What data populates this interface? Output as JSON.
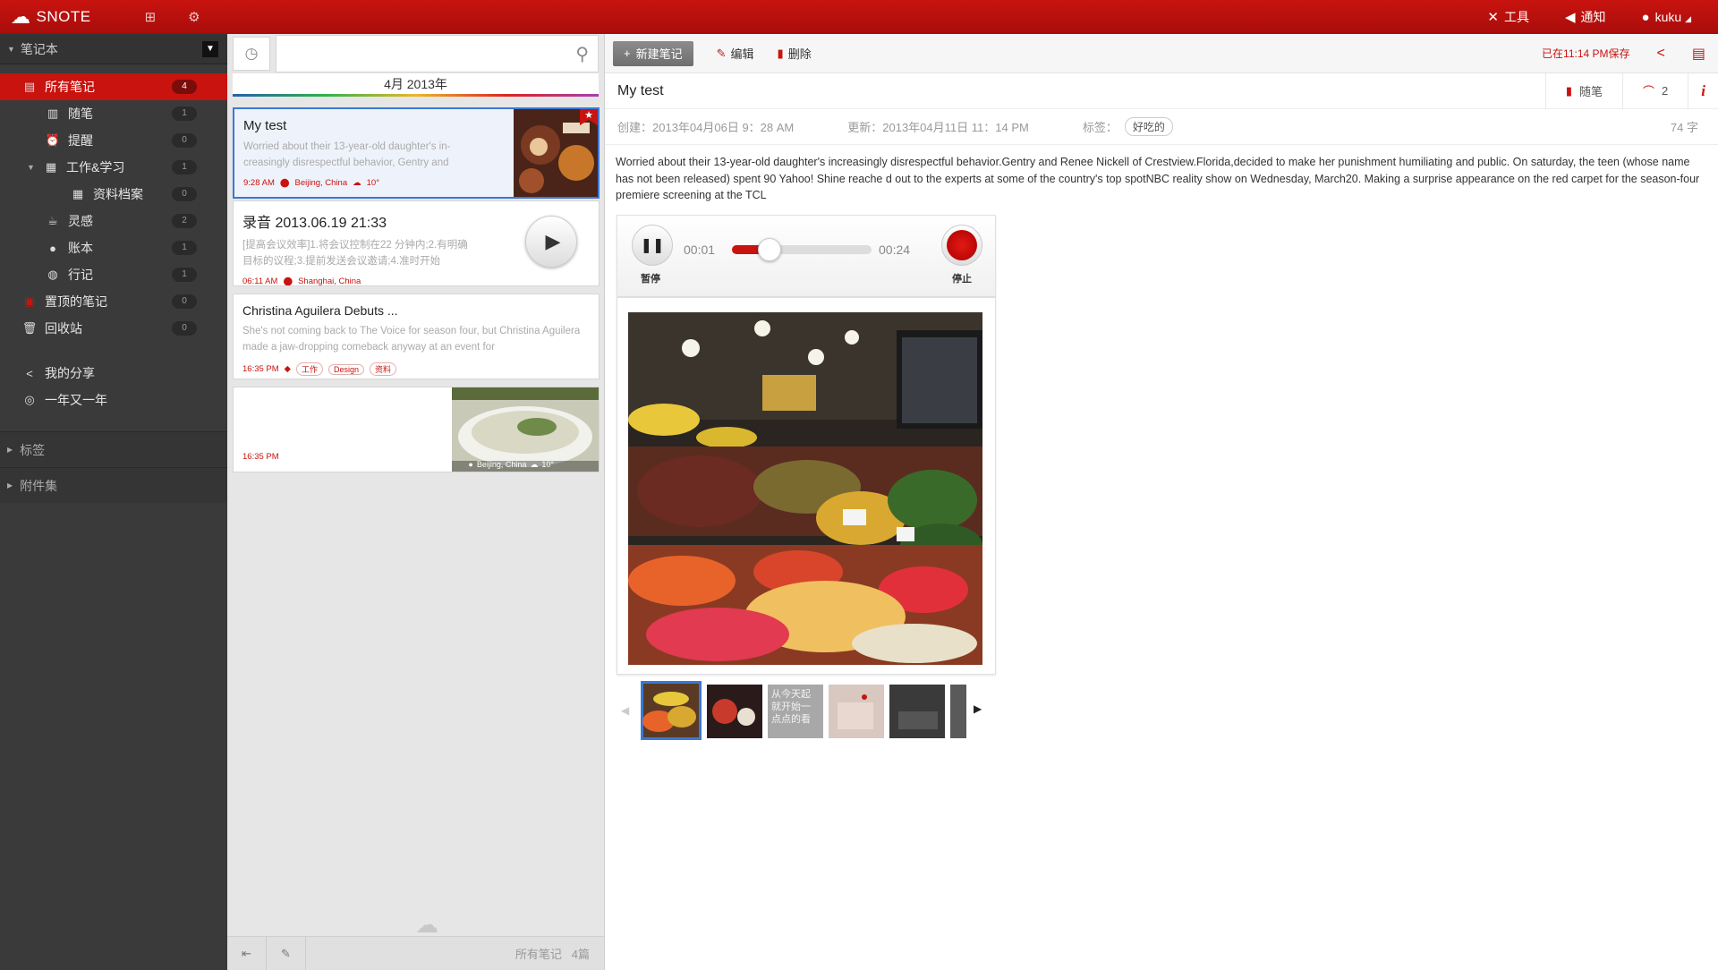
{
  "app": {
    "name": "SNOTE",
    "tools": "工具",
    "notify": "通知",
    "user": "kuku"
  },
  "sidebar": {
    "header": "笔记本",
    "items": [
      {
        "label": "所有笔记",
        "count": "4",
        "icon": "notebook-icon"
      },
      {
        "label": "随笔",
        "count": "1",
        "icon": "book-icon"
      },
      {
        "label": "提醒",
        "count": "0",
        "icon": "alarm-icon"
      },
      {
        "label": "工作&学习",
        "count": "1",
        "icon": "books-icon"
      },
      {
        "label": "资料档案",
        "count": "0",
        "icon": "archive-icon"
      },
      {
        "label": "灵感",
        "count": "2",
        "icon": "cup-icon"
      },
      {
        "label": "账本",
        "count": "1",
        "icon": "piggy-bank-icon"
      },
      {
        "label": "行记",
        "count": "1",
        "icon": "speech-icon"
      },
      {
        "label": "置顶的笔记",
        "count": "0",
        "icon": "pin-icon"
      },
      {
        "label": "回收站",
        "count": "0",
        "icon": "trash-icon"
      }
    ],
    "extras": [
      {
        "label": "我的分享",
        "icon": "share-icon"
      },
      {
        "label": "一年又一年",
        "icon": "swirl-icon"
      }
    ],
    "sections": [
      "标签",
      "附件集"
    ]
  },
  "list": {
    "month": "4月 2013年",
    "notes": [
      {
        "title": "My test",
        "desc": "Worried about their 13-year-old daughter's in-creasingly disrespectful behavior, Gentry and",
        "time": "9:28 AM",
        "location": "Beijing, China",
        "weather": "10°"
      },
      {
        "title": "录音 2013.06.19 21:33",
        "desc": "[提高会议效率]1.将会议控制在22 分钟内;2.有明确目标的议程;3.提前发送会议邀请;4.准时开始",
        "time": "06:11 AM",
        "location": "Shanghai, China"
      },
      {
        "title": "Christina Aguilera Debuts ...",
        "desc": "She's not coming back to The Voice for season four, but Christina Aguilera made a jaw-dropping comeback anyway at an event for",
        "time": "16:35 PM",
        "tags": [
          "工作",
          "Design",
          "资料"
        ]
      },
      {
        "time": "16:35 PM",
        "location": "Beijing, China",
        "weather": "10°"
      }
    ],
    "footer": {
      "label": "所有笔记",
      "count": "4篇"
    }
  },
  "main": {
    "toolbar": {
      "new": "新建笔记",
      "edit": "编辑",
      "delete": "删除",
      "saved": "已在11:14 PM保存"
    },
    "title": "My test",
    "notebook": "随笔",
    "attachments": "2",
    "meta": {
      "created": "创建：2013年04月06日 9：28 AM",
      "updated": "更新：2013年04月11日 11：14 PM",
      "tags_label": "标签：",
      "tag": "好吃的",
      "words": "74 字"
    },
    "body": "Worried about their 13-year-old daughter's increasingly disrespectful behavior.Gentry and  Renee Nickell of Crestview.Florida,decided to make her punishment humiliating and public.  On saturday, the teen (whose name has not been released) spent 90 Yahoo! Shine reache d out to the experts at some of the country's top spotNBC reality show on Wednesday, March20. Making a surprise appearance on the red carpet for the season-four premiere screening at the TCL",
    "audio": {
      "elapsed": "00:01",
      "total": "00:24",
      "pause": "暂停",
      "stop": "停止",
      "progress": 0.2
    },
    "thumb_text": "从今天起就开始一点点的看"
  },
  "colors": {
    "accent": "#c8130f",
    "selection": "#3a78d6"
  }
}
